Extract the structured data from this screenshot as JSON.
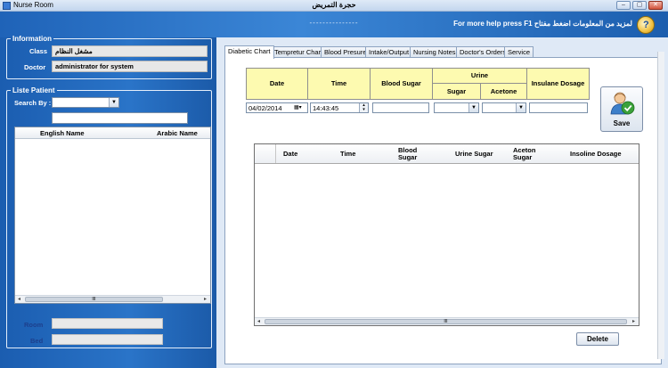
{
  "window": {
    "title": "Nurse Room",
    "center_title": "حجرة التمريض",
    "minimize": "‒",
    "maximize": "▢",
    "close": "✕"
  },
  "banner": {
    "dashes": "---------------",
    "help_text": "For more help press F1  لمزيد من المعلومات اضغط مفتاح",
    "help_icon": "help-icon"
  },
  "information": {
    "legend": "Information",
    "class_label": "Class",
    "class_value": "مشغل النظام",
    "doctor_label": "Doctor",
    "doctor_value": "administrator for system"
  },
  "patients": {
    "legend": "Liste Patient",
    "search_label": "Search By :",
    "search_value": "",
    "search_text": "",
    "columns": [
      "English Name",
      "Arabic Name"
    ],
    "scroll_left": "◂",
    "scroll_right": "▸",
    "grip": "III"
  },
  "room": {
    "room_label": "Room",
    "bed_label": "Bed"
  },
  "tabs": [
    "Diabetic Chart",
    "Tempretur Chart",
    "Blood Presure",
    "Intake/Output",
    "Nursing Notes",
    "Doctor's Orders",
    "Service"
  ],
  "diabetic": {
    "headers": {
      "date": "Date",
      "time": "Time",
      "blood_sugar": "Blood Sugar",
      "urine": "Urine",
      "urine_sugar": "Sugar",
      "acetone": "Acetone",
      "insulane": "Insulane Dosage"
    },
    "date_value": "04/02/2014",
    "time_value": "14:43:45",
    "save_label": "Save",
    "grid_columns": {
      "date": "Date",
      "time": "Time",
      "blood_sugar": "Blood Sugar",
      "urine_sugar": "Urine Sugar",
      "aceton_sugar": "Aceton Sugar",
      "insoline": "Insoline Dosage"
    },
    "delete_label": "Delete"
  },
  "colors": {
    "banner": "#1f63b8",
    "header_yellow": "#fdfab0",
    "panel": "#dfe9f6"
  }
}
